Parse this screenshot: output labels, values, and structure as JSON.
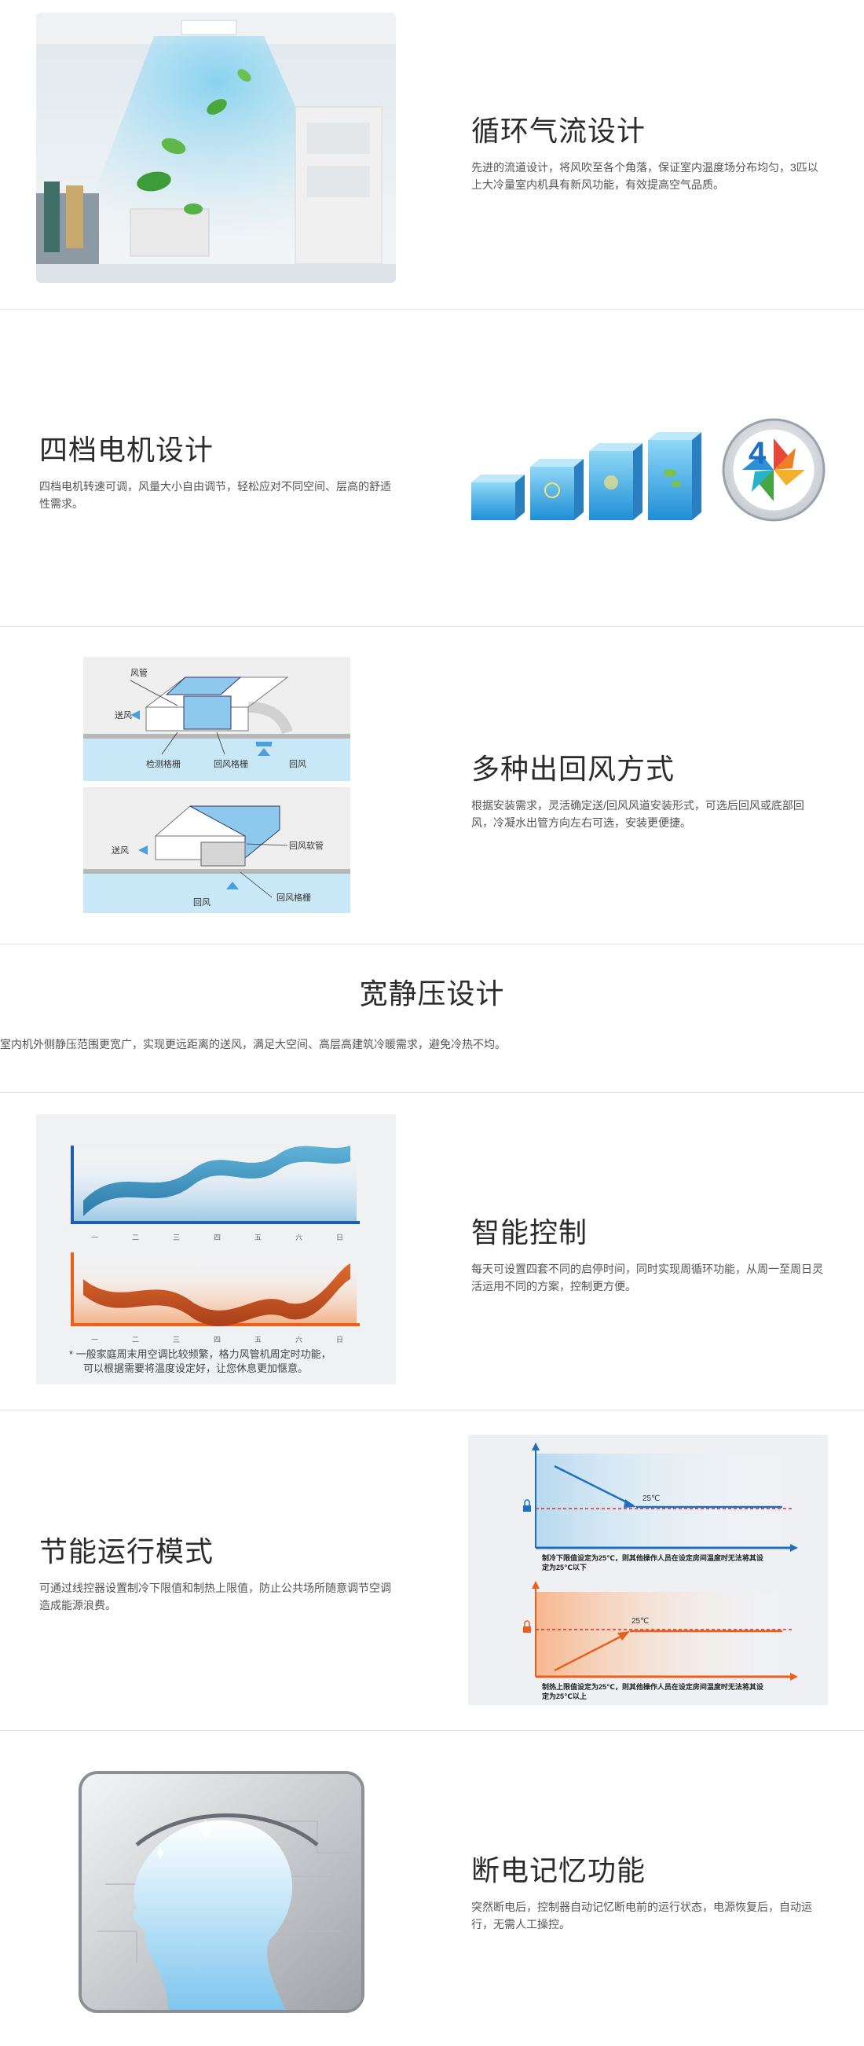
{
  "sections": {
    "airflow": {
      "title": "循环气流设计",
      "desc": "先进的流道设计，将风吹至各个角落，保证室内温度场分布均匀，3匹以上大冷量室内机具有新风功能，有效提高空气品质。"
    },
    "motor": {
      "title": "四档电机设计",
      "desc": "四档电机转速可调，风量大小自由调节，轻松应对不同空间、层高的舒适性需求。"
    },
    "return": {
      "title": "多种出回风方式",
      "desc": "根据安装需求，灵活确定送/回风风道安装形式，可选后回风或底部回风，冷凝水出管方向左右可选，安装更便捷。",
      "diagram": {
        "top": {
          "duct": "风管",
          "supply": "送风",
          "grille_check": "检测格栅",
          "grille_return": "回风格栅",
          "return": "回风"
        },
        "bottom": {
          "supply": "送风",
          "soft_duct": "回风软管",
          "return": "回风",
          "grille_return": "回风格栅"
        }
      }
    },
    "pressure": {
      "title": "宽静压设计",
      "desc": "室内机外侧静压范围更宽广，实现更远距离的送风，满足大空间、高层高建筑冷暖需求，避免冷热不均。"
    },
    "smart": {
      "title": "智能控制",
      "desc": "每天可设置四套不同的启停时间，同时实现周循环功能，从周一至周日灵活运用不同的方案，控制更方便。",
      "days": [
        "一",
        "二",
        "三",
        "四",
        "五",
        "六",
        "日"
      ],
      "note_line1": "* 一般家庭周末用空调比较频繁，格力风管机周定时功能，",
      "note_line2": "可以根据需要将温度设定好，让您休息更加惬意。"
    },
    "energy": {
      "title": "节能运行模式",
      "desc": "可通过线控器设置制冷下限值和制热上限值，防止公共场所随意调节空调造成能源浪费。",
      "cool_temp": "25℃",
      "cool_caption1": "制冷下限值设定为25℃，则其他操作人员在设定房间温度时无法将其设",
      "cool_caption2": "定为25℃以下",
      "heat_temp": "25℃",
      "heat_caption1": "制热上限值设定为25℃，则其他操作人员在设定房间温度时无法将其设",
      "heat_caption2": "定为25℃以上"
    },
    "memory": {
      "title": "断电记忆功能",
      "desc": "突然断电后，控制器自动记忆断电前的运行状态，电源恢复后，自动运行，无需人工操控。"
    }
  },
  "colors": {
    "blue": "#1f6fc0",
    "orange": "#e8601c",
    "wave_blue": "#4a9fc8",
    "wave_orange": "#c9541e"
  }
}
